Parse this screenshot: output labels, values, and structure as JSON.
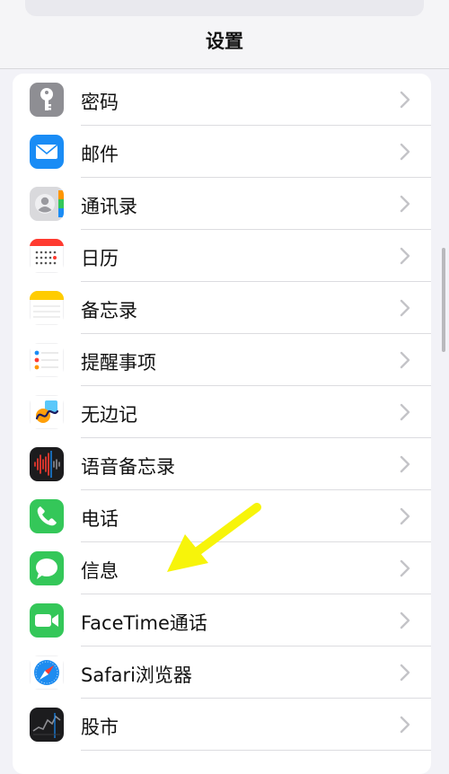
{
  "header": {
    "title": "设置"
  },
  "items": [
    {
      "key": "passwords",
      "label": "密码",
      "icon": "key-icon"
    },
    {
      "key": "mail",
      "label": "邮件",
      "icon": "mail-icon"
    },
    {
      "key": "contacts",
      "label": "通讯录",
      "icon": "contacts-icon"
    },
    {
      "key": "calendar",
      "label": "日历",
      "icon": "calendar-icon"
    },
    {
      "key": "notes",
      "label": "备忘录",
      "icon": "notes-icon"
    },
    {
      "key": "reminders",
      "label": "提醒事项",
      "icon": "reminders-icon"
    },
    {
      "key": "freeform",
      "label": "无边记",
      "icon": "freeform-icon"
    },
    {
      "key": "voice-memos",
      "label": "语音备忘录",
      "icon": "voice-memos-icon"
    },
    {
      "key": "phone",
      "label": "电话",
      "icon": "phone-icon"
    },
    {
      "key": "messages",
      "label": "信息",
      "icon": "messages-icon"
    },
    {
      "key": "facetime",
      "label": "FaceTime通话",
      "icon": "facetime-icon"
    },
    {
      "key": "safari",
      "label": "Safari浏览器",
      "icon": "safari-icon"
    },
    {
      "key": "stocks",
      "label": "股市",
      "icon": "stocks-icon"
    }
  ],
  "annotation": {
    "icon": "yellow-arrow-icon",
    "color": "#f7f40a"
  },
  "colors": {
    "background": "#f2f2f7",
    "chevron": "#c4c4c8",
    "mail": "#1a8cf5",
    "phone": "#34c759",
    "messages": "#34c759",
    "facetime": "#34c759",
    "safari": "#1e8cf0"
  }
}
